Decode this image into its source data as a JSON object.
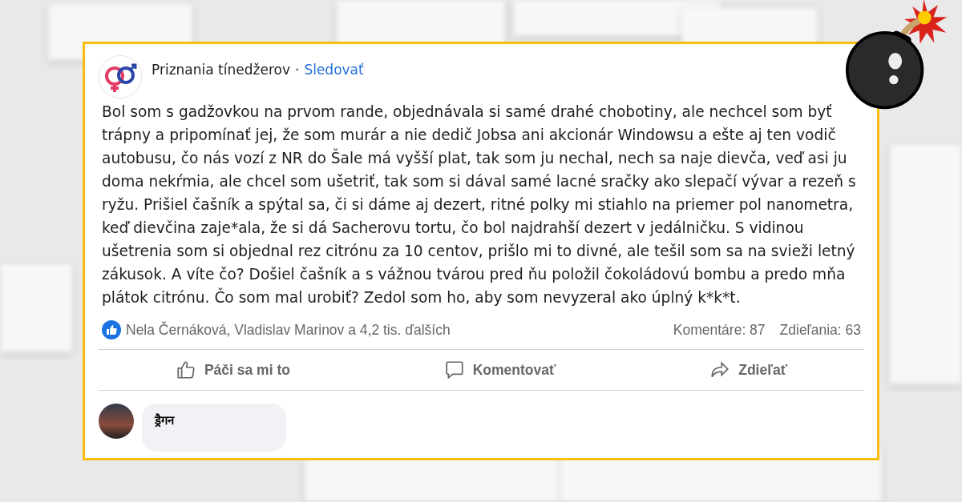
{
  "post": {
    "page_name": "Priznania tínedžerov",
    "separator": "·",
    "follow": "Sledovať",
    "text": "Bol som s gadžovkou na prvom rande, objednávala si samé drahé chobotiny, ale nechcel som byť trápny a pripomínať jej, že som murár a nie dedič Jobsa ani akcionár Windowsu a ešte aj ten vodič autobusu, čo nás vozí z NR do Šale má vyšší plat, tak som ju nechal, nech sa naje dievča, veď asi ju doma nekŕmia, ale chcel som ušetriť, tak som si dával samé lacné sračky ako slepačí vývar a rezeň s ryžu. Prišiel čašník a spýtal sa, či si dáme aj dezert, ritné polky mi stiahlo na priemer pol nanometra, keď dievčina zaje*ala, že si dá Sacherovu tortu, čo bol najdrahší dezert v jedálničku. S vidinou ušetrenia som si objednal rez citrónu za 10 centov, prišlo mi to divné, ale tešil som sa na svieži letný zákusok. A víte čo? Došiel čašník a s vážnou tvárou pred ňu položil čokoládovú bombu a predo mňa plátok citrónu. Čo som mal urobiť? Zedol som ho, aby som nevyzeral ako úplný k*k*t.",
    "reactions": "Nela Černáková, Vladislav Marinov a 4,2 tis. ďalších",
    "comments_count": "Komentáre: 87",
    "shares_count": "Zdieľania: 63",
    "actions": [
      {
        "kind": "like",
        "label": "Páči sa mi to"
      },
      {
        "kind": "comment",
        "label": "Komentovať"
      },
      {
        "kind": "share",
        "label": "Zdieľať"
      }
    ],
    "comment": {
      "author": "ड्रैगन"
    }
  }
}
